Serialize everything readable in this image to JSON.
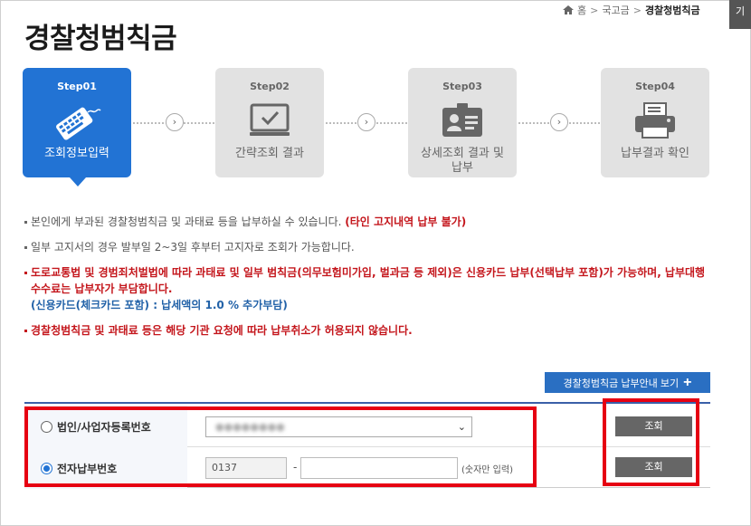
{
  "side_tab": "기",
  "breadcrumb": {
    "home": "홈",
    "sep1": ">",
    "parent": "국고금",
    "sep2": ">",
    "current": "경찰청범칙금"
  },
  "page_title": "경찰청범칙금",
  "steps": [
    {
      "num": "Step01",
      "label": "조회정보입력",
      "icon": "keyboard-icon",
      "active": true
    },
    {
      "num": "Step02",
      "label": "간략조회 결과",
      "icon": "monitor-icon",
      "active": false
    },
    {
      "num": "Step03",
      "label": "상세조회 결과 및\n납부",
      "icon": "id-card-icon",
      "active": false
    },
    {
      "num": "Step04",
      "label": "납부결과 확인",
      "icon": "printer-icon",
      "active": false
    }
  ],
  "notices": {
    "n1_text": "본인에게 부과된 경찰청범칙금 및 과태료 등을 납부하실 수 있습니다. ",
    "n1_red": "(타인 고지내역 납부 불가)",
    "n2_text": "일부 고지서의 경우 발부일 2~3일 후부터 고지자로 조회가 가능합니다.",
    "n3_text": "도로교통법 및 경범죄처벌법에 따라 과태료 및 일부 범칙금(의무보험미가입, 벌과금 등 제외)은 신용카드 납부(선택납부 포함)가 가능하며, 납부대행수수료는 납부자가 부담합니다.",
    "n3_blue": "(신용카드(체크카드 포함) : 납세액의 1.0 % 추가부담)",
    "n4_text": "경찰청범칙금 및 과태료 등은 해당 기관 요청에 따라 납부취소가 허용되지 않습니다."
  },
  "guide_button": {
    "label": "경찰청범칙금 납부안내 보기",
    "icon": "plus-icon"
  },
  "form": {
    "row1": {
      "label": "법인/사업자등록번호",
      "selected": "●●●●●●●●",
      "button": "조회",
      "checked": false
    },
    "row2": {
      "label": "전자납부번호",
      "prefix": "0137",
      "dash": "-",
      "value": "",
      "hint": "(숫자만 입력)",
      "button": "조회",
      "checked": true
    }
  },
  "colors": {
    "accent": "#2273d4",
    "highlight": "#e60012",
    "notice_red": "#c4161c",
    "notice_blue": "#2262a8"
  }
}
